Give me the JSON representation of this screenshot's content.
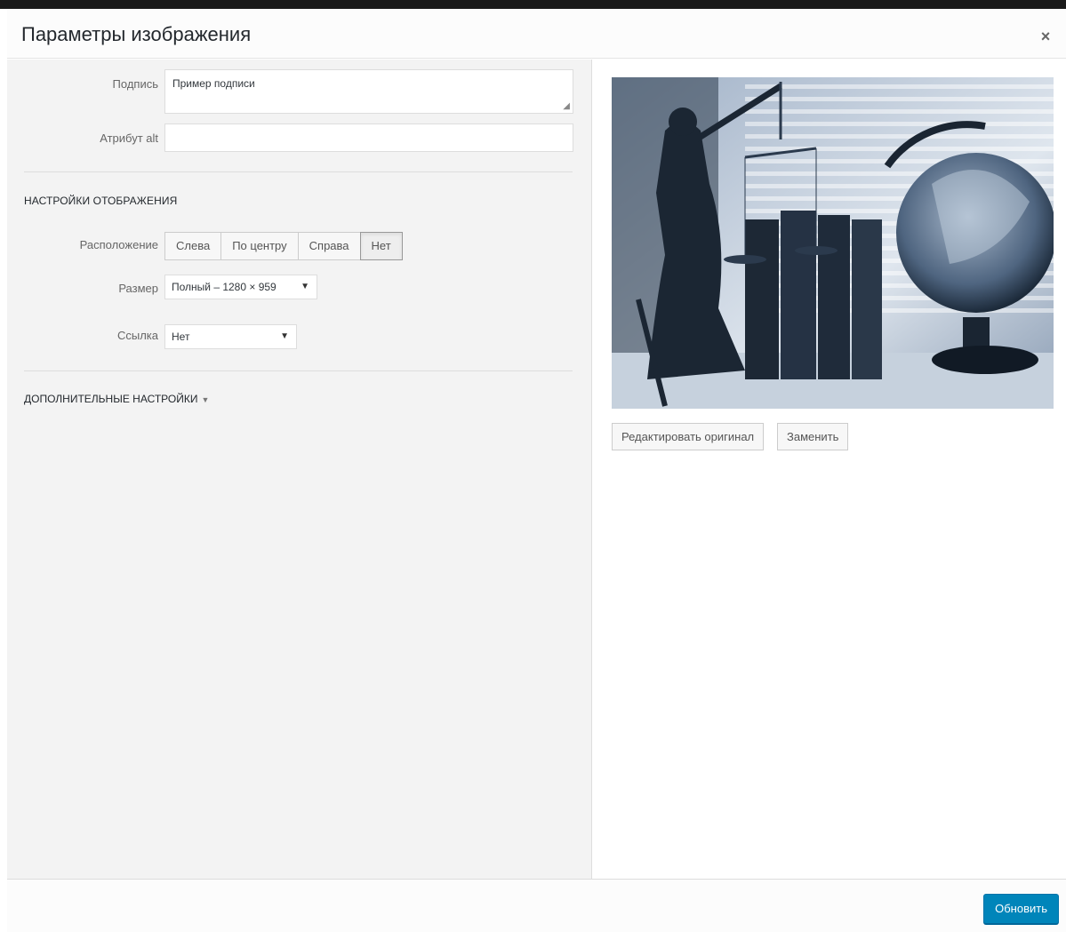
{
  "modal": {
    "title": "Параметры изображения",
    "close_glyph": "×"
  },
  "fields": {
    "caption_label": "Подпись",
    "caption_value": "Пример подписи",
    "alt_label": "Атрибут alt",
    "alt_value": ""
  },
  "display_settings": {
    "title": "НАСТРОЙКИ ОТОБРАЖЕНИЯ",
    "align_label": "Расположение",
    "align_options": [
      "Слева",
      "По центру",
      "Справа",
      "Нет"
    ],
    "align_selected": "Нет",
    "size_label": "Размер",
    "size_value": "Полный – 1280 × 959",
    "link_label": "Ссылка",
    "link_value": "Нет"
  },
  "advanced": {
    "label": "ДОПОЛНИТЕЛЬНЫЕ НАСТРОЙКИ"
  },
  "preview": {
    "edit_label": "Редактировать оригинал",
    "replace_label": "Заменить"
  },
  "footer": {
    "update_label": "Обновить"
  },
  "colors": {
    "primary": "#0085ba",
    "left_pane_bg": "#f3f3f3"
  }
}
